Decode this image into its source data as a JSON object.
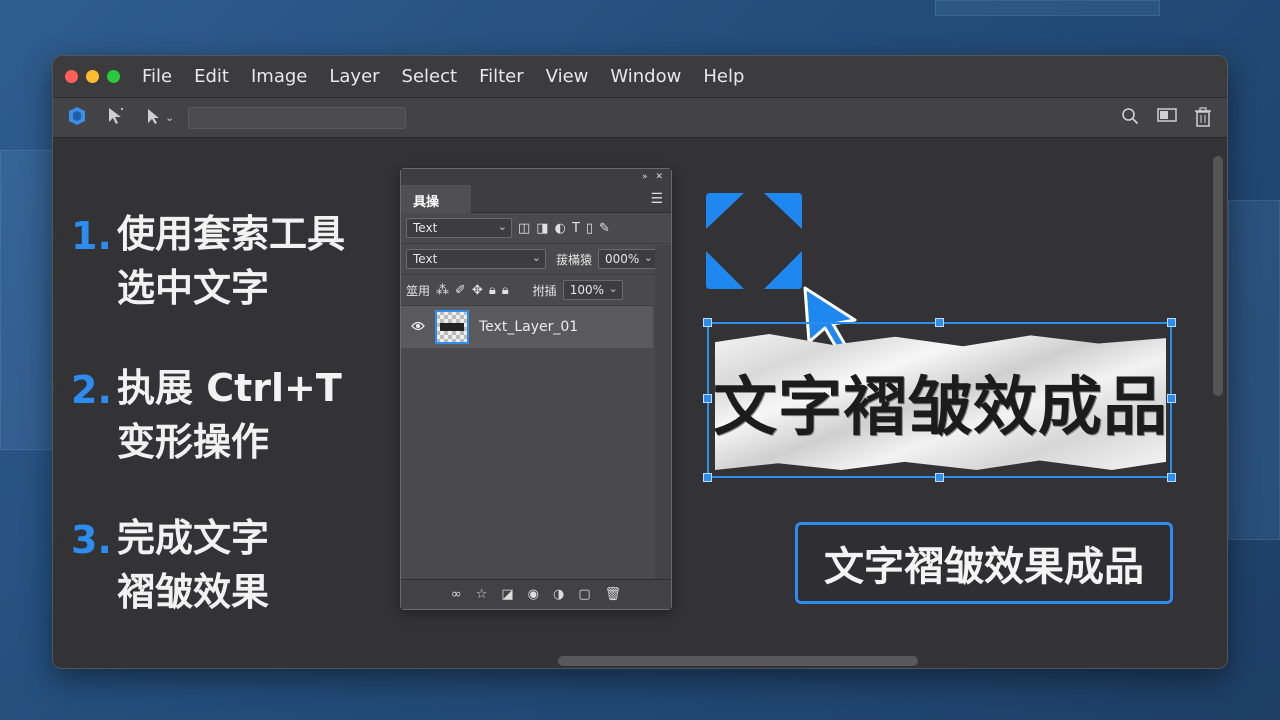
{
  "menubar": {
    "items": [
      "File",
      "Edit",
      "Image",
      "Layer",
      "Select",
      "Filter",
      "View",
      "Window",
      "Help"
    ]
  },
  "toolbar": {
    "icons": [
      "app-logo-icon",
      "move-tool-icon",
      "select-tool-icon",
      "chevron-down-icon",
      "search-icon",
      "layout-icon",
      "trash-icon"
    ]
  },
  "steps": [
    {
      "num": "1.",
      "line1": "使用套索工具",
      "line2": "选中文字"
    },
    {
      "num": "2.",
      "line1": "执展 Ctrl+T",
      "line2": "变形操作"
    },
    {
      "num": "3.",
      "line1": "完成文字",
      "line2": "褶皱效果"
    }
  ],
  "panel": {
    "tab": "具操",
    "row1_select": "Text",
    "row2_select": "Text",
    "row2_label": "菝樠猿",
    "row2_value": "000%",
    "row3_label1": "筮用",
    "row3_label2": "拊插",
    "row3_value": "100%",
    "layer_name": "Text_Layer_01"
  },
  "canvas": {
    "paper_text": "文字褶皱效成品",
    "result_text": "文字褶皱效果成品"
  },
  "colors": {
    "accent": "#2d8cf0",
    "window_bg": "#3a3a3c",
    "canvas_bg": "#333335"
  }
}
